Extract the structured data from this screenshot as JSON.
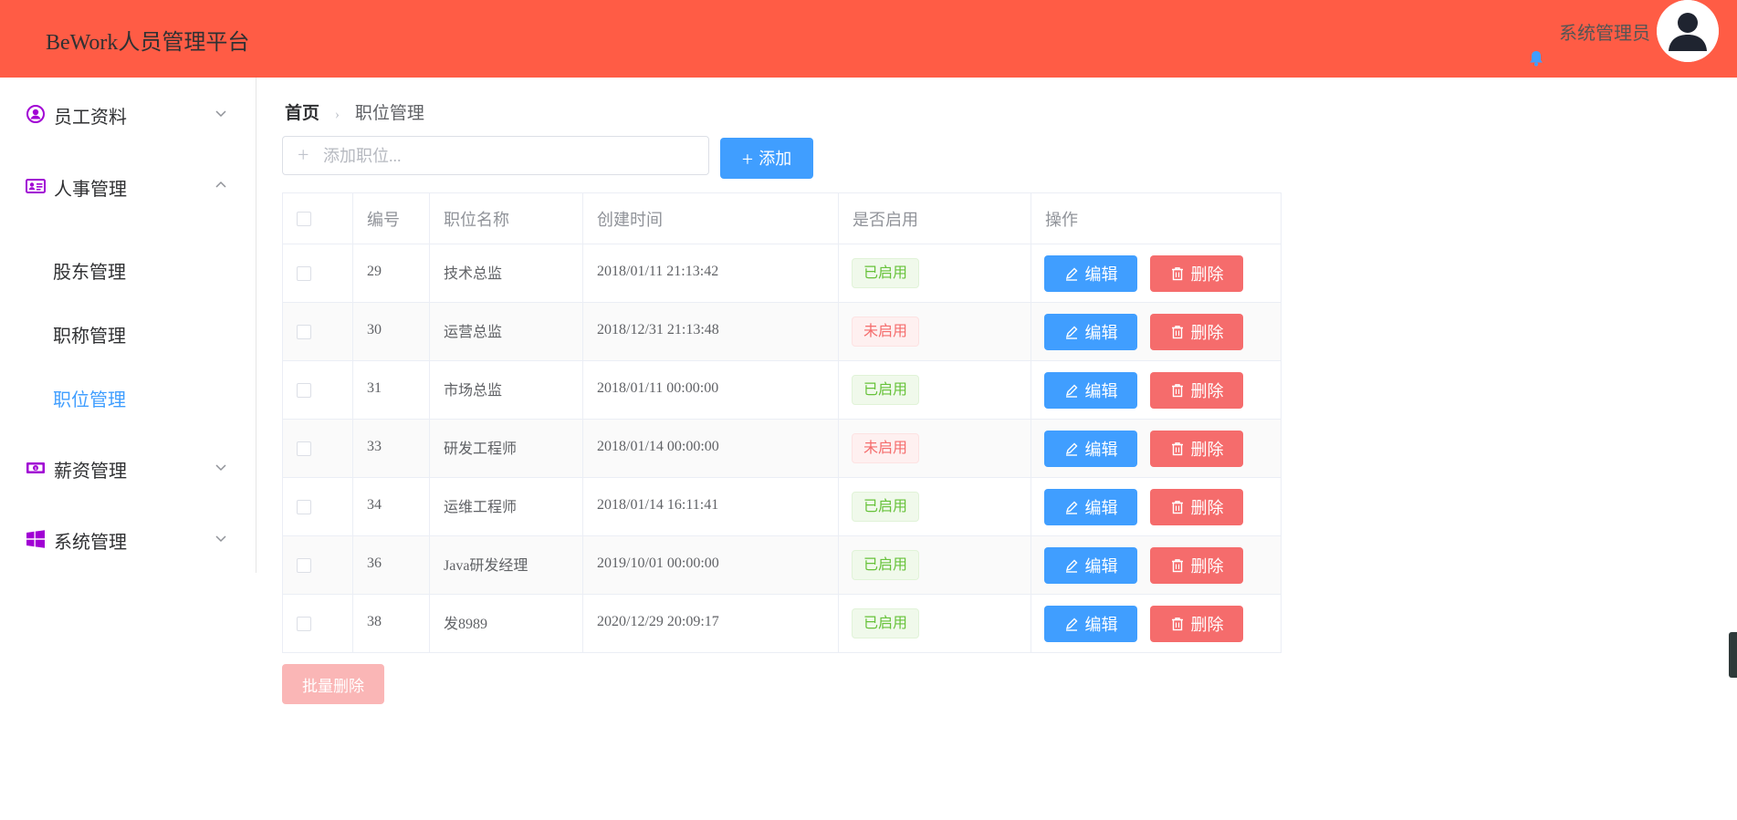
{
  "header": {
    "app_title": "BeWork人员管理平台",
    "user_name": "系统管理员",
    "bg_color": "#ff5c45"
  },
  "sidebar": {
    "groups": [
      {
        "label": "员工资料",
        "icon": "user-circle-icon",
        "expanded": false
      },
      {
        "label": "人事管理",
        "icon": "id-card-icon",
        "expanded": true
      },
      {
        "label": "薪资管理",
        "icon": "money-icon",
        "expanded": false
      },
      {
        "label": "系统管理",
        "icon": "windows-icon",
        "expanded": false
      }
    ],
    "sub_items": [
      {
        "label": "股东管理",
        "active": false
      },
      {
        "label": "职称管理",
        "active": false
      },
      {
        "label": "职位管理",
        "active": true
      }
    ],
    "icon_color": "#a100d4"
  },
  "breadcrumb": {
    "home": "首页",
    "current": "职位管理"
  },
  "toolbar": {
    "add_placeholder": "添加职位...",
    "add_value": "",
    "add_button": "添加"
  },
  "table": {
    "headers": [
      "编号",
      "职位名称",
      "创建时间",
      "是否启用",
      "操作"
    ],
    "rows": [
      {
        "id": "29",
        "name": "技术总监",
        "created": "2018/01/11 21:13:42",
        "status": "已启用",
        "enabled": true
      },
      {
        "id": "30",
        "name": "运营总监",
        "created": "2018/12/31 21:13:48",
        "status": "未启用",
        "enabled": false
      },
      {
        "id": "31",
        "name": "市场总监",
        "created": "2018/01/11 00:00:00",
        "status": "已启用",
        "enabled": true
      },
      {
        "id": "33",
        "name": "研发工程师",
        "created": "2018/01/14 00:00:00",
        "status": "未启用",
        "enabled": false
      },
      {
        "id": "34",
        "name": "运维工程师",
        "created": "2018/01/14 16:11:41",
        "status": "已启用",
        "enabled": true
      },
      {
        "id": "36",
        "name": "Java研发经理",
        "created": "2019/10/01 00:00:00",
        "status": "已启用",
        "enabled": true
      },
      {
        "id": "38",
        "name": "发8989",
        "created": "2020/12/29 20:09:17",
        "status": "已启用",
        "enabled": true
      }
    ],
    "edit_label": "编辑",
    "delete_label": "删除"
  },
  "batch_delete_label": "批量删除",
  "colors": {
    "primary": "#409eff",
    "danger": "#f56c6c",
    "success": "#67c23a"
  }
}
